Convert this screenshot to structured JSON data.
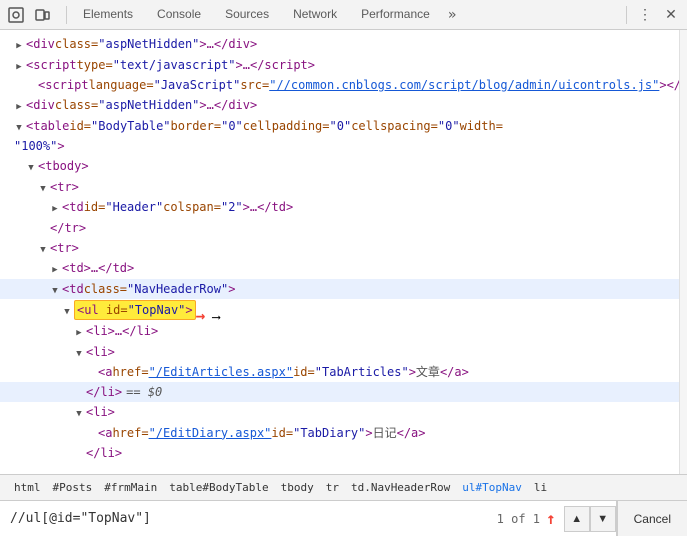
{
  "toolbar": {
    "tabs": [
      {
        "label": "Elements",
        "active": false
      },
      {
        "label": "Console",
        "active": false
      },
      {
        "label": "Sources",
        "active": false
      },
      {
        "label": "Network",
        "active": false
      },
      {
        "label": "Performance",
        "active": false
      }
    ]
  },
  "tree": {
    "lines": [
      {
        "id": "line1",
        "depth": 1,
        "arrow": "collapsed",
        "html": "div_aspNetHidden_1"
      },
      {
        "id": "line2",
        "depth": 1,
        "arrow": "collapsed",
        "html": "script_text_javascript"
      },
      {
        "id": "line3",
        "depth": 2,
        "arrow": "leaf",
        "html": "script_language"
      },
      {
        "id": "line4",
        "depth": 1,
        "arrow": "collapsed",
        "html": "div_aspNetHidden_2"
      },
      {
        "id": "line5",
        "depth": 1,
        "arrow": "expanded",
        "html": "table_BodyTable"
      },
      {
        "id": "line6",
        "depth": 2,
        "arrow": "expanded",
        "html": "tbody"
      },
      {
        "id": "line7",
        "depth": 3,
        "arrow": "expanded",
        "html": "tr_1"
      },
      {
        "id": "line8",
        "depth": 4,
        "arrow": "collapsed",
        "html": "td_Header"
      },
      {
        "id": "line9",
        "depth": 3,
        "arrow": "leaf",
        "html": "tr_close_1"
      },
      {
        "id": "line10",
        "depth": 3,
        "arrow": "expanded",
        "html": "tr_2"
      },
      {
        "id": "line11",
        "depth": 4,
        "arrow": "collapsed",
        "html": "td_dots"
      },
      {
        "id": "line12",
        "depth": 4,
        "arrow": "expanded",
        "html": "td_NavHeaderRow",
        "selected": true
      },
      {
        "id": "line13",
        "depth": 5,
        "arrow": "expanded",
        "html": "ul_TopNav",
        "highlighted": true,
        "red_arrow": true
      },
      {
        "id": "line14",
        "depth": 6,
        "arrow": "collapsed",
        "html": "li_dots"
      },
      {
        "id": "line15",
        "depth": 6,
        "arrow": "expanded",
        "html": "li_articles"
      },
      {
        "id": "line16",
        "depth": 7,
        "arrow": "leaf",
        "html": "a_EditArticles"
      },
      {
        "id": "line17",
        "depth": 6,
        "arrow": "leaf",
        "html": "li_close_eq"
      },
      {
        "id": "line18",
        "depth": 6,
        "arrow": "expanded",
        "html": "li_diary"
      },
      {
        "id": "line19",
        "depth": 7,
        "arrow": "leaf",
        "html": "a_EditDiary"
      },
      {
        "id": "line20",
        "depth": 6,
        "arrow": "leaf",
        "html": "li_close_diary"
      }
    ]
  },
  "breadcrumb": {
    "items": [
      {
        "label": "html",
        "colored": false
      },
      {
        "label": "#Posts",
        "colored": false
      },
      {
        "label": "#frmMain",
        "colored": false
      },
      {
        "label": "table#BodyTable",
        "colored": false
      },
      {
        "label": "tbody",
        "colored": false
      },
      {
        "label": "tr",
        "colored": false
      },
      {
        "label": "td.NavHeaderRow",
        "colored": false
      },
      {
        "label": "ul#TopNav",
        "colored": true
      },
      {
        "label": "li",
        "colored": false
      }
    ]
  },
  "search": {
    "value": "//ul[@id=\"TopNav\"]",
    "count": "1 of 1",
    "cancel_label": "Cancel"
  }
}
